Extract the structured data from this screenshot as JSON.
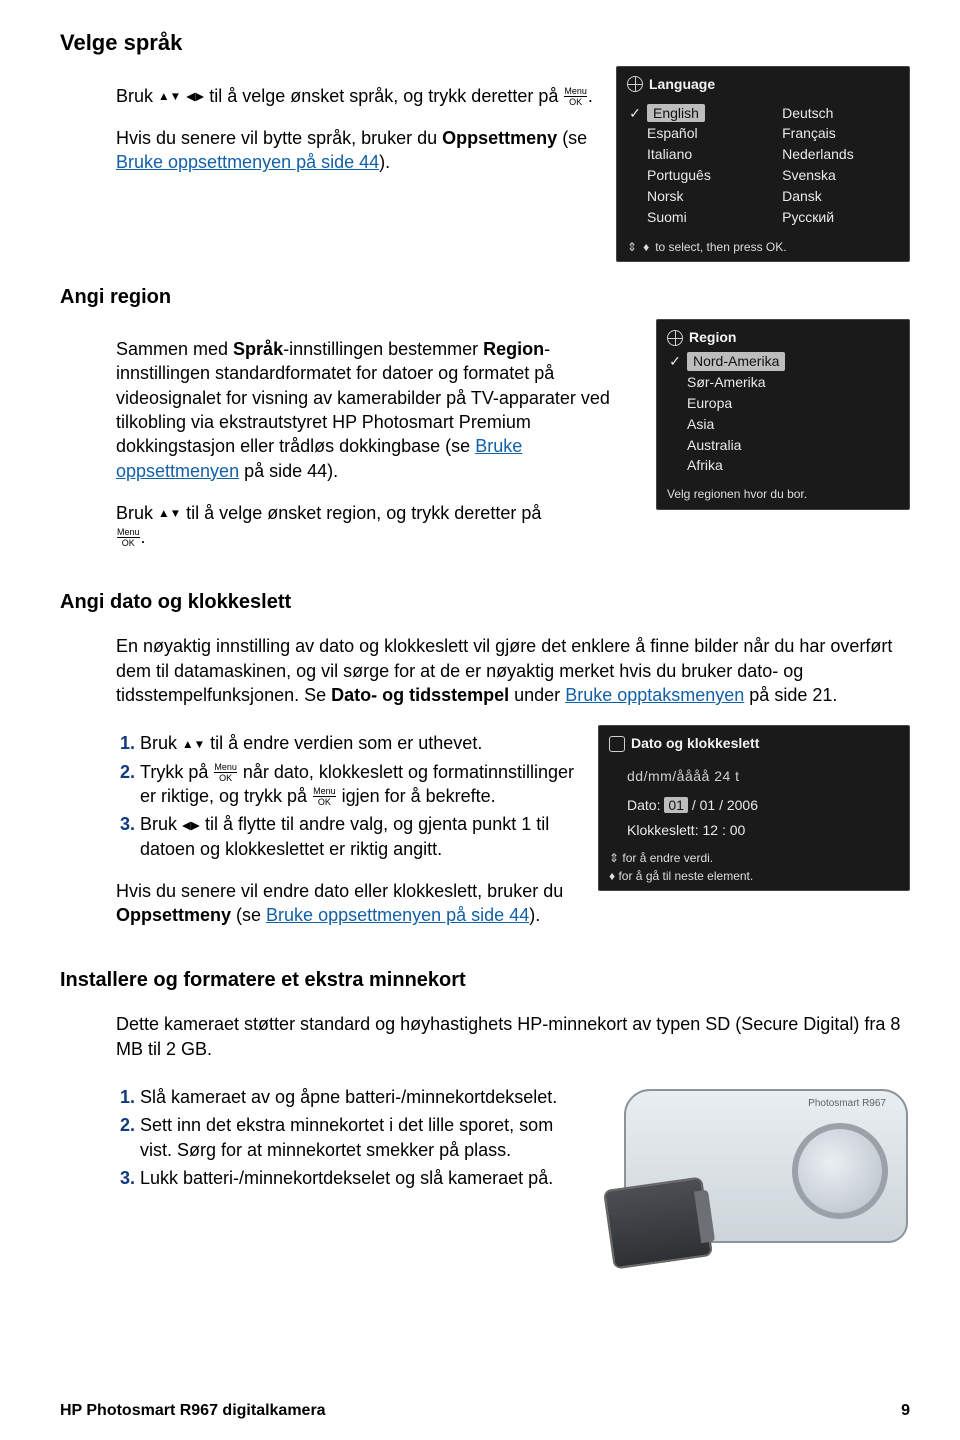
{
  "section1": {
    "title": "Velge språk",
    "p1a": "Bruk ",
    "p1b": " til å velge ønsket språk, og trykk deretter på ",
    "p1c": ".",
    "p2a": "Hvis du senere vil bytte språk, bruker du ",
    "p2b": "Oppsettmeny",
    "p2c": " (se ",
    "p2link": "Bruke oppsettmenyen på side 44",
    "p2d": ")."
  },
  "langShot": {
    "title": "Language",
    "items": [
      [
        "English",
        "Deutsch"
      ],
      [
        "Español",
        "Français"
      ],
      [
        "Italiano",
        "Nederlands"
      ],
      [
        "Português",
        "Svenska"
      ],
      [
        "Norsk",
        "Dansk"
      ],
      [
        "Suomi",
        "Русский"
      ]
    ],
    "selected": "English",
    "footer": "to select, then press OK."
  },
  "section2": {
    "title": "Angi region",
    "p1a": "Sammen med ",
    "p1b": "Språk",
    "p1c": "-innstillingen bestemmer ",
    "p1d": "Region",
    "p1e": "-innstillingen standardformatet for datoer og formatet på videosignalet for visning av kamerabilder på TV-apparater ved tilkobling via ekstrautstyret HP Photosmart Premium dokkingstasjon eller trådløs dokkingbase (se ",
    "p1link": "Bruke oppsettmenyen",
    "p1f": " på side 44).",
    "p2a": "Bruk ",
    "p2b": " til å velge ønsket region, og trykk deretter på ",
    "p2c": "."
  },
  "regionShot": {
    "title": "Region",
    "items": [
      "Nord-Amerika",
      "Sør-Amerika",
      "Europa",
      "Asia",
      "Australia",
      "Afrika"
    ],
    "selected": "Nord-Amerika",
    "caption": "Velg regionen hvor du bor."
  },
  "section3": {
    "title": "Angi dato og klokkeslett",
    "p1": "En nøyaktig innstilling av dato og klokkeslett vil gjøre det enklere å finne bilder når du har overført dem til datamaskinen, og vil sørge for at de er nøyaktig merket hvis du bruker dato- og tidsstempelfunksjonen. Se ",
    "p1b": "Dato- og tidsstempel",
    "p1c": " under ",
    "p1link": "Bruke opptaksmenyen",
    "p1d": " på side 21.",
    "steps": {
      "s1a": "Bruk ",
      "s1b": " til å endre verdien som er uthevet.",
      "s2a": "Trykk på ",
      "s2b": " når dato, klokkeslett og formatinnstillinger er riktige, og trykk på ",
      "s2c": " igjen for å bekrefte.",
      "s3a": "Bruk ",
      "s3b": " til å flytte til andre valg, og gjenta punkt 1 til datoen og klokkeslettet er riktig angitt."
    },
    "p2a": "Hvis du senere vil endre dato eller klokkeslett, bruker du ",
    "p2b": "Oppsettmeny",
    "p2c": " (se ",
    "p2link": "Bruke oppsettmenyen på side 44",
    "p2d": ")."
  },
  "dateShot": {
    "title": "Dato og klokkeslett",
    "fmt": "dd/mm/åååå  24 t",
    "dateLabel": "Dato:",
    "d1": "01",
    "d2": "01",
    "d3": "2006",
    "timeLabel": "Klokkeslett:",
    "t1": "12",
    "t2": "00",
    "legend1": "for å endre verdi.",
    "legend2": "for å gå til neste element."
  },
  "section4": {
    "title": "Installere og formatere et ekstra minnekort",
    "p1": "Dette kameraet støtter standard og høyhastighets HP-minnekort av typen SD (Secure Digital) fra 8 MB til 2 GB.",
    "steps": {
      "s1": "Slå kameraet av og åpne batteri-/minnekortdekselet.",
      "s2": "Sett inn det ekstra minnekortet i det lille sporet, som vist. Sørg for at minnekortet smekker på plass.",
      "s3": "Lukk batteri-/minnekortdekselet og slå kameraet på."
    },
    "cameraLabel": "Photosmart R967"
  },
  "footer": {
    "left": "HP Photosmart R967 digitalkamera",
    "right": "9"
  },
  "icon": {
    "menu": "Menu",
    "ok": "OK"
  }
}
